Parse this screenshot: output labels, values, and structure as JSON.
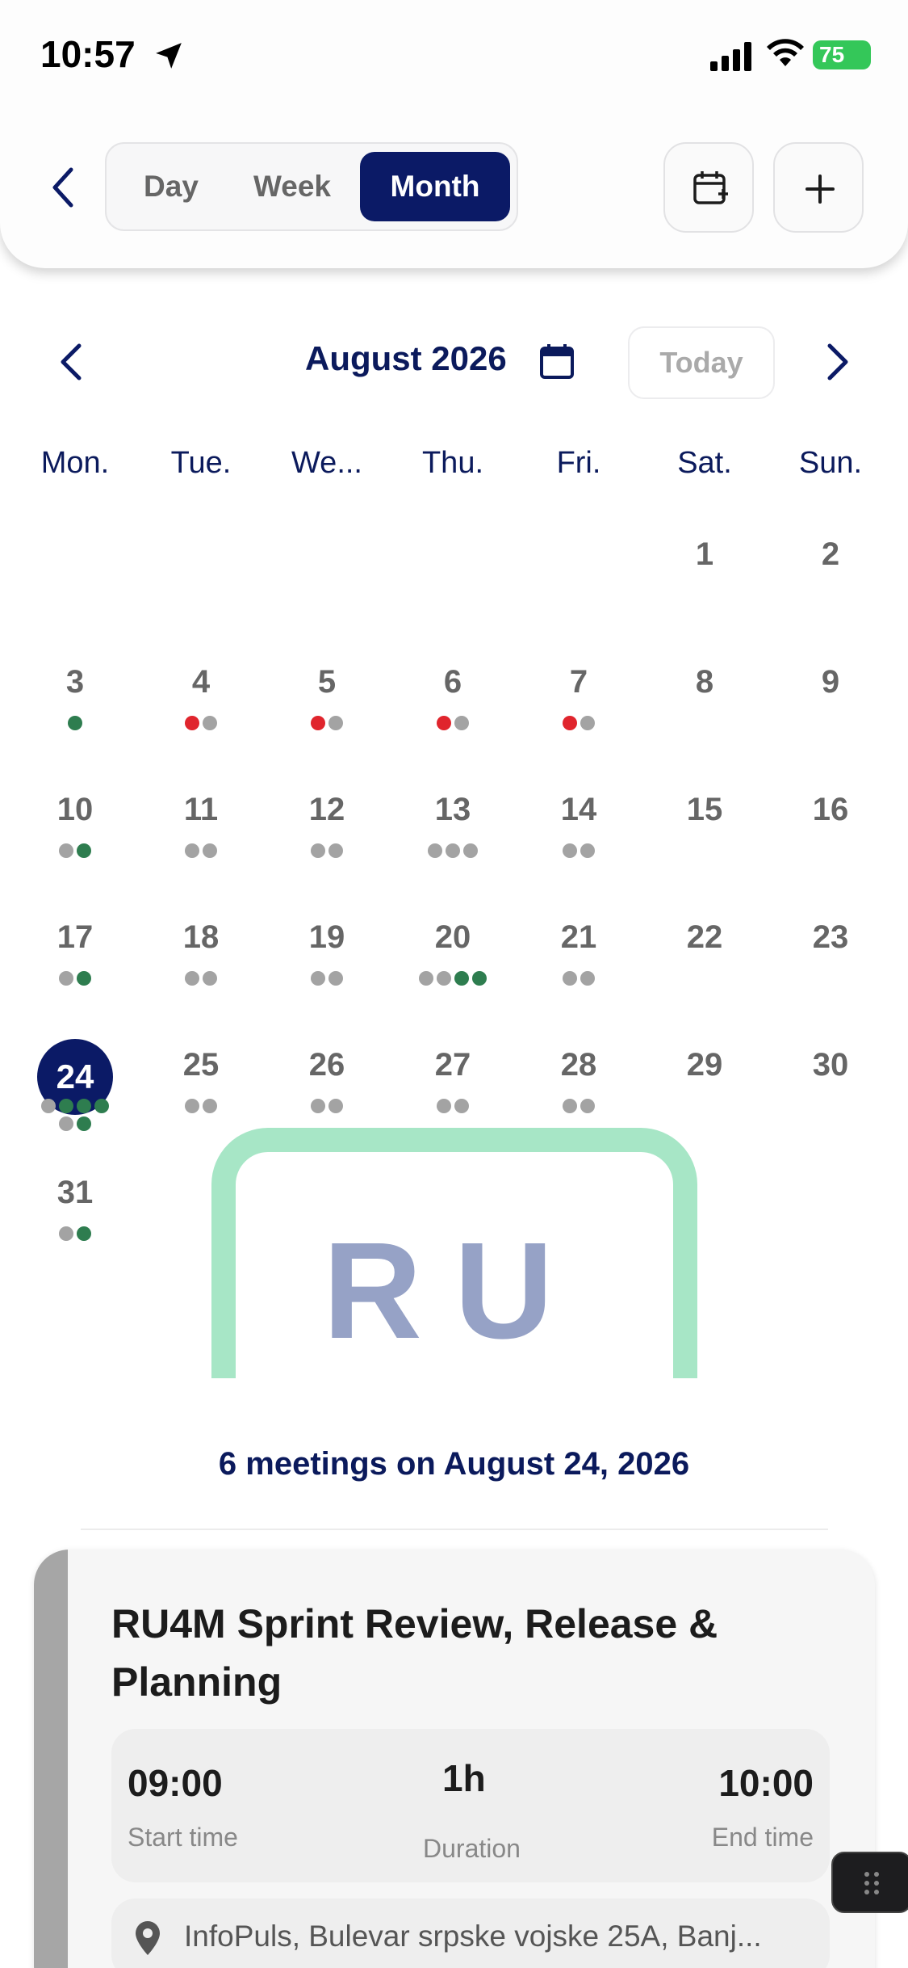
{
  "status_bar": {
    "time": "10:57",
    "battery": "75"
  },
  "header": {
    "tabs": [
      {
        "label": "Day",
        "active": false
      },
      {
        "label": "Week",
        "active": false
      },
      {
        "label": "Month",
        "active": true
      }
    ]
  },
  "calendar": {
    "month_title": "August 2026",
    "today_label": "Today",
    "weekdays": [
      "Mon.",
      "Tue.",
      "We...",
      "Thu.",
      "Fri.",
      "Sat.",
      "Sun."
    ],
    "selected_day": "24",
    "days": [
      {
        "n": "1",
        "dots": []
      },
      {
        "n": "2",
        "dots": []
      },
      {
        "n": "3",
        "dots": [
          "gr"
        ]
      },
      {
        "n": "4",
        "dots": [
          "r",
          "g"
        ]
      },
      {
        "n": "5",
        "dots": [
          "r",
          "g"
        ]
      },
      {
        "n": "6",
        "dots": [
          "r",
          "g"
        ]
      },
      {
        "n": "7",
        "dots": [
          "r",
          "g"
        ]
      },
      {
        "n": "8",
        "dots": []
      },
      {
        "n": "9",
        "dots": []
      },
      {
        "n": "10",
        "dots": [
          "g",
          "gr"
        ]
      },
      {
        "n": "11",
        "dots": [
          "g",
          "g"
        ]
      },
      {
        "n": "12",
        "dots": [
          "g",
          "g"
        ]
      },
      {
        "n": "13",
        "dots": [
          "g",
          "g",
          "g"
        ]
      },
      {
        "n": "14",
        "dots": [
          "g",
          "g"
        ]
      },
      {
        "n": "15",
        "dots": []
      },
      {
        "n": "16",
        "dots": []
      },
      {
        "n": "17",
        "dots": [
          "g",
          "gr"
        ]
      },
      {
        "n": "18",
        "dots": [
          "g",
          "g"
        ]
      },
      {
        "n": "19",
        "dots": [
          "g",
          "g"
        ]
      },
      {
        "n": "20",
        "dots": [
          "g",
          "g",
          "gr",
          "gr"
        ]
      },
      {
        "n": "21",
        "dots": [
          "g",
          "g"
        ]
      },
      {
        "n": "22",
        "dots": []
      },
      {
        "n": "23",
        "dots": []
      },
      {
        "n": "24",
        "dots": [
          "g",
          "gr",
          "gr",
          "gr",
          "g",
          "gr"
        ]
      },
      {
        "n": "25",
        "dots": [
          "g",
          "g"
        ]
      },
      {
        "n": "26",
        "dots": [
          "g",
          "g"
        ]
      },
      {
        "n": "27",
        "dots": [
          "g",
          "g"
        ]
      },
      {
        "n": "28",
        "dots": [
          "g",
          "g"
        ]
      },
      {
        "n": "29",
        "dots": []
      },
      {
        "n": "30",
        "dots": []
      },
      {
        "n": "31",
        "dots": [
          "g",
          "gr"
        ]
      }
    ]
  },
  "watermark": {
    "text": "RU"
  },
  "meetings": {
    "heading": "6 meetings on August 24, 2026",
    "cards": [
      {
        "title": "RU4M Sprint Review, Release & Planning",
        "start_time": "09:00",
        "start_label": "Start time",
        "duration": "1h",
        "duration_label": "Duration",
        "end_time": "10:00",
        "end_label": "End time",
        "location": "InfoPuls, Bulevar srpske vojske 25A, Banj..."
      }
    ]
  },
  "colors": {
    "primary": "#0b1a66",
    "red_dot": "#e0252d",
    "green_dot": "#2e7d4f",
    "gray_dot": "#a3a3a3"
  }
}
